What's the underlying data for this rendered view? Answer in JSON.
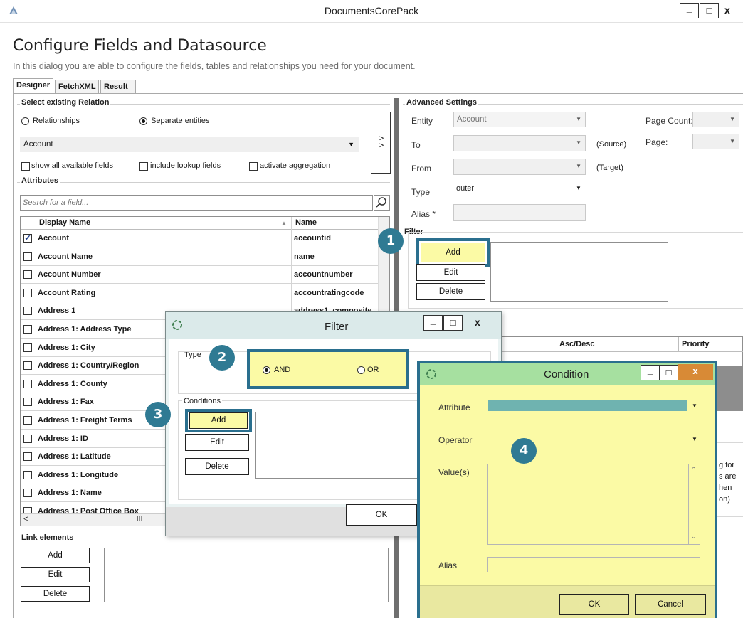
{
  "window": {
    "title": "DocumentsCorePack",
    "min": "_",
    "max": "□",
    "close": "x"
  },
  "header": {
    "title": "Configure Fields and Datasource",
    "subtitle": "In this dialog you are able to configure the fields, tables and relationships you need for your document."
  },
  "tabs": [
    {
      "label": "Designer"
    },
    {
      "label": "FetchXML"
    },
    {
      "label": "Result"
    }
  ],
  "relation": {
    "group_label": "Select existing Relation",
    "radio_relationships": "Relationships",
    "radio_separate": "Separate entities",
    "entity_value": "Account",
    "move_button": "> >",
    "chk_show_all": "show all available fields",
    "chk_lookup": "include lookup fields",
    "chk_aggregation": "activate aggregation"
  },
  "attributes": {
    "group_label": "Attributes",
    "search_placeholder": "Search for a field...",
    "col_display": "Display Name",
    "col_name": "Name",
    "rows": [
      {
        "display": "Account",
        "name": "accountid",
        "checked": true
      },
      {
        "display": "Account Name",
        "name": "name",
        "checked": false
      },
      {
        "display": "Account Number",
        "name": "accountnumber",
        "checked": false
      },
      {
        "display": "Account Rating",
        "name": "accountratingcode",
        "checked": false
      },
      {
        "display": "Address 1",
        "name": "address1_composite",
        "checked": false
      },
      {
        "display": "Address 1: Address Type",
        "name": "",
        "checked": false
      },
      {
        "display": "Address 1: City",
        "name": "",
        "checked": false
      },
      {
        "display": "Address 1: Country/Region",
        "name": "",
        "checked": false
      },
      {
        "display": "Address 1: County",
        "name": "",
        "checked": false
      },
      {
        "display": "Address 1: Fax",
        "name": "",
        "checked": false
      },
      {
        "display": "Address 1: Freight Terms",
        "name": "",
        "checked": false
      },
      {
        "display": "Address 1: ID",
        "name": "",
        "checked": false
      },
      {
        "display": "Address 1: Latitude",
        "name": "",
        "checked": false
      },
      {
        "display": "Address 1: Longitude",
        "name": "",
        "checked": false
      },
      {
        "display": "Address 1: Name",
        "name": "",
        "checked": false
      },
      {
        "display": "Address 1: Post Office Box",
        "name": "",
        "checked": false
      }
    ],
    "scroll_left": "<",
    "scroll_mid": "III"
  },
  "link_elements": {
    "label": "Link elements",
    "add": "Add",
    "edit": "Edit",
    "delete": "Delete"
  },
  "advanced": {
    "group_label": "Advanced Settings",
    "entity_label": "Entity",
    "entity_value": "Account",
    "to_label": "To",
    "source_label": "(Source)",
    "from_label": "From",
    "target_label": "(Target)",
    "type_label": "Type",
    "type_value": "outer",
    "alias_label": "Alias *",
    "page_count_label": "Page Count:",
    "page_label": "Page:",
    "filter_label": "Filter",
    "filter_add": "Add",
    "filter_edit": "Edit",
    "filter_delete": "Delete",
    "sort_col_ascdesc": "Asc/Desc",
    "sort_col_priority": "Priority",
    "right_text_lines": [
      "g for",
      "s are",
      "hen",
      "on)"
    ]
  },
  "filter_dialog": {
    "title": "Filter",
    "type_label": "Type",
    "opt_and": "AND",
    "opt_or": "OR",
    "conditions_label": "Conditions",
    "add": "Add",
    "edit": "Edit",
    "delete": "Delete",
    "ok": "OK"
  },
  "condition_dialog": {
    "title": "Condition",
    "attribute_label": "Attribute",
    "operator_label": "Operator",
    "values_label": "Value(s)",
    "alias_label": "Alias",
    "ok": "OK",
    "cancel": "Cancel"
  },
  "callouts": [
    "1",
    "2",
    "3",
    "4"
  ],
  "colors": {
    "accent": "#2f7a93",
    "highlight_border": "#2a6f8e",
    "condition_bg": "#fbfaa5",
    "condition_title": "#a6e0a0"
  }
}
